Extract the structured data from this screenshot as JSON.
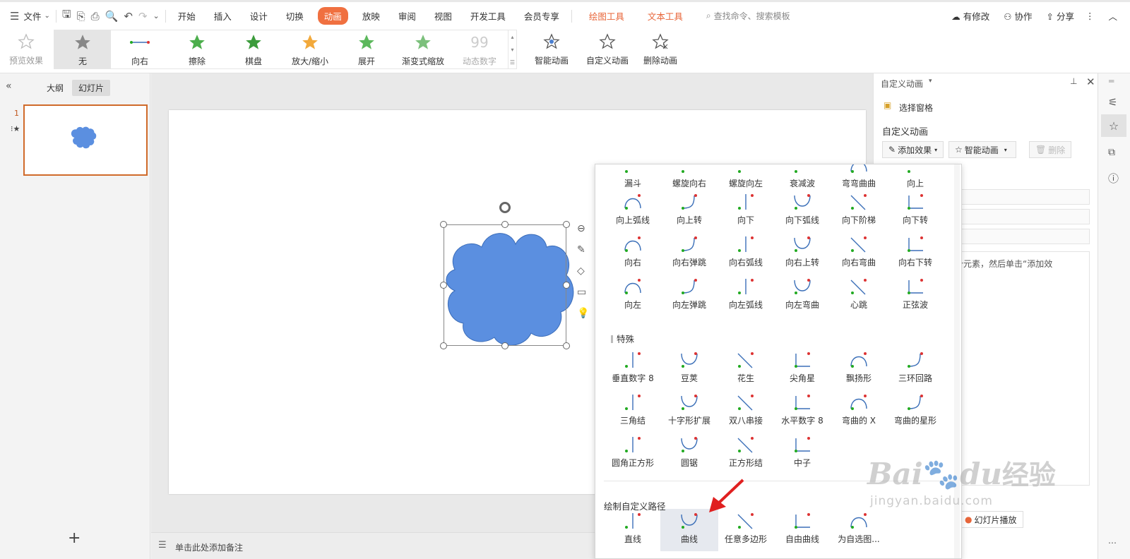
{
  "menubar": {
    "file": "文件",
    "tabs": [
      "开始",
      "插入",
      "设计",
      "切换",
      "动画",
      "放映",
      "审阅",
      "视图",
      "开发工具",
      "会员专享"
    ],
    "active_tab": "动画",
    "context_tabs": [
      "绘图工具",
      "文本工具"
    ],
    "search_placeholder": "查找命令、搜索模板",
    "modified": "有修改",
    "collab": "协作",
    "share": "分享"
  },
  "ribbon": {
    "preview": "预览效果",
    "gallery": [
      "无",
      "向右",
      "擦除",
      "棋盘",
      "放大/缩小",
      "展开",
      "渐变式缩放",
      "动态数字"
    ],
    "smart_anim": "智能动画",
    "custom_anim": "自定义动画",
    "delete_anim": "删除动画"
  },
  "left": {
    "tab_outline": "大纲",
    "tab_slides": "幻灯片",
    "slide_number": "1",
    "add": "+"
  },
  "notes_placeholder": "单击此处添加备注",
  "right": {
    "title": "自定义动画",
    "select_pane": "选择窗格",
    "section": "自定义动画",
    "add_effect": "添加效果",
    "smart_anim": "智能动画",
    "delete": "删除",
    "hint": "某个元素，然后单击“添加效",
    "slideshow": "幻灯片播放"
  },
  "dropdown": {
    "row0": [
      "漏斗",
      "螺旋向右",
      "螺旋向左",
      "衰减波",
      "弯弯曲曲",
      "向上"
    ],
    "row1": [
      "向上弧线",
      "向上转",
      "向下",
      "向下弧线",
      "向下阶梯",
      "向下转"
    ],
    "row2": [
      "向右",
      "向右弹跳",
      "向右弧线",
      "向右上转",
      "向右弯曲",
      "向右下转"
    ],
    "row3": [
      "向左",
      "向左弹跳",
      "向左弧线",
      "向左弯曲",
      "心跳",
      "正弦波"
    ],
    "special_title": "特殊",
    "special1": [
      "垂直数字 8",
      "豆荚",
      "花生",
      "尖角星",
      "飘扬形",
      "三环回路"
    ],
    "special2": [
      "三角结",
      "十字形扩展",
      "双八串接",
      "水平数字 8",
      "弯曲的 X",
      "弯曲的星形"
    ],
    "special3": [
      "圆角正方形",
      "圆锯",
      "正方形结",
      "中子"
    ],
    "custom_title": "绘制自定义路径",
    "custom": [
      "直线",
      "曲线",
      "任意多边形",
      "自由曲线",
      "为自选图..."
    ]
  },
  "watermark": {
    "brand": "Bai",
    "brand2": "du",
    "cn": "经验",
    "url": "jingyan.baidu.com"
  },
  "colors": {
    "accent": "#f07040",
    "shape": "#5b8fe0",
    "path": "#3b6fb8"
  }
}
